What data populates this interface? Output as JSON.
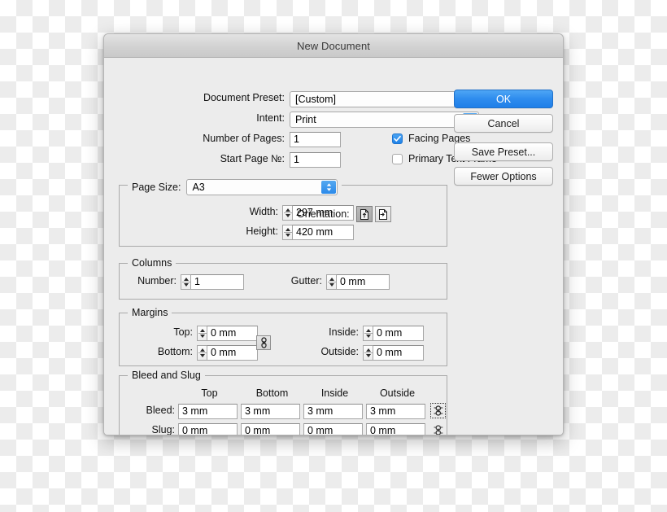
{
  "window": {
    "title": "New Document"
  },
  "fields": {
    "document_preset_label": "Document Preset:",
    "document_preset_value": "[Custom]",
    "intent_label": "Intent:",
    "intent_value": "Print",
    "number_of_pages_label": "Number of Pages:",
    "number_of_pages_value": "1",
    "start_page_label": "Start Page №:",
    "start_page_value": "1",
    "facing_pages_label": "Facing Pages",
    "facing_pages_checked": "true",
    "primary_text_frame_label": "Primary Text Frame",
    "primary_text_frame_checked": "false"
  },
  "page_size": {
    "legend": "Page Size:",
    "value": "A3",
    "width_label": "Width:",
    "width_value": "297 mm",
    "height_label": "Height:",
    "height_value": "420 mm",
    "orientation_label": "Orientation:",
    "orientation_portrait": "portrait",
    "orientation_landscape": "landscape",
    "orientation_selected": "portrait"
  },
  "columns": {
    "legend": "Columns",
    "number_label": "Number:",
    "number_value": "1",
    "gutter_label": "Gutter:",
    "gutter_value": "0 mm"
  },
  "margins": {
    "legend": "Margins",
    "top_label": "Top:",
    "top_value": "0 mm",
    "bottom_label": "Bottom:",
    "bottom_value": "0 mm",
    "inside_label": "Inside:",
    "inside_value": "0 mm",
    "outside_label": "Outside:",
    "outside_value": "0 mm"
  },
  "bleed_and_slug": {
    "legend": "Bleed and Slug",
    "columns": [
      "Top",
      "Bottom",
      "Inside",
      "Outside"
    ],
    "bleed_label": "Bleed:",
    "bleed_values": [
      "3 mm",
      "3 mm",
      "3 mm",
      "3 mm"
    ],
    "slug_label": "Slug:",
    "slug_values": [
      "0 mm",
      "0 mm",
      "0 mm",
      "0 mm"
    ]
  },
  "buttons": {
    "ok": "OK",
    "cancel": "Cancel",
    "save_preset": "Save Preset...",
    "fewer_options": "Fewer Options"
  },
  "colors": {
    "accent_blue": "#2e8cee",
    "dialog_bg": "#ececec",
    "titlebar": "#d2d2d2",
    "group_border": "#a9a9a9"
  }
}
